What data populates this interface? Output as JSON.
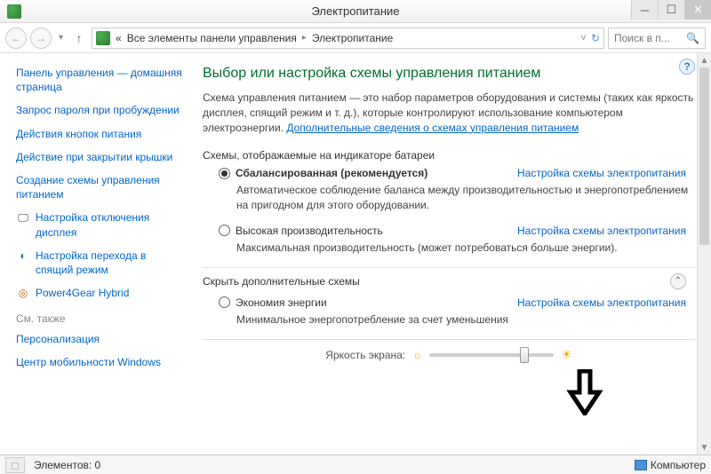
{
  "titlebar": {
    "title": "Электропитание"
  },
  "nav": {
    "crumb_prefix": "«",
    "crumb1": "Все элементы панели управления",
    "crumb2": "Электропитание",
    "search_placeholder": "Поиск в п..."
  },
  "sidebar": {
    "home": "Панель управления — домашняя страница",
    "links": [
      "Запрос пароля при пробуждении",
      "Действия кнопок питания",
      "Действие при закрытии крышки",
      "Создание схемы управления питанием"
    ],
    "icon_links": [
      {
        "icon": "display-off-icon",
        "label": "Настройка отключения дисплея"
      },
      {
        "icon": "sleep-icon",
        "label": "Настройка перехода в спящий режим"
      },
      {
        "icon": "power4gear-icon",
        "label": "Power4Gear Hybrid"
      }
    ],
    "see_also": "См. также",
    "see_links": [
      "Персонализация",
      "Центр мобильности Windows"
    ]
  },
  "main": {
    "title": "Выбор или настройка схемы управления питанием",
    "desc_before": "Схема управления питанием — это набор параметров оборудования и системы (таких как яркость дисплея, спящий режим и т. д.), которые контролируют использование компьютером электроэнергии. ",
    "desc_link": "Дополнительные сведения о схемах управления питанием",
    "section1": "Схемы, отображаемые на индикаторе батареи",
    "plans": [
      {
        "selected": true,
        "name": "Сбалансированная (рекомендуется)",
        "link": "Настройка схемы электропитания",
        "desc": "Автоматическое соблюдение баланса между производительностью и энергопотреблением на пригодном для этого оборудовании."
      },
      {
        "selected": false,
        "name": "Высокая производительность",
        "link": "Настройка схемы электропитания",
        "desc": "Максимальная производительность (может потребоваться больше энергии)."
      }
    ],
    "section2": "Скрыть дополнительные схемы",
    "extra_plan": {
      "selected": false,
      "name": "Экономия энергии",
      "link": "Настройка схемы электропитания",
      "desc": "Минимальное энергопотребление за счет уменьшения"
    },
    "brightness_label": "Яркость экрана:",
    "brightness_percent": 78
  },
  "statusbar": {
    "elements": "Элементов: 0",
    "computer": "Компьютер"
  }
}
